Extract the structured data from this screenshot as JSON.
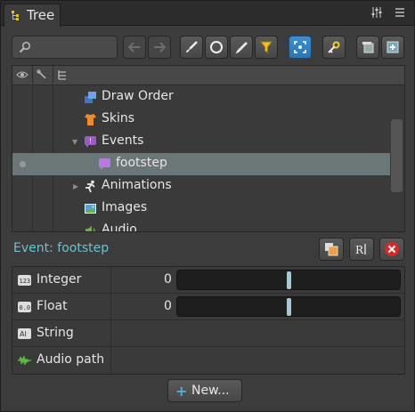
{
  "tab": {
    "title": "Tree",
    "icon": "tree-icon"
  },
  "tab_tools": [
    "settings-sliders-icon",
    "menu-icon"
  ],
  "toolbar": {
    "search_value": "",
    "search_icon": "search-icon",
    "buttons": [
      "back-arrow-icon",
      "forward-arrow-icon",
      "brush-icon",
      "circle-icon",
      "pen-icon",
      "filter-icon",
      "focus-icon",
      "key-icon",
      "collapse-icon",
      "add-panel-icon"
    ],
    "active_accent": "#2f83c8"
  },
  "tree": {
    "columns": [
      "visibility-eye-icon",
      "bone-link-icon",
      "hierarchy-icon"
    ],
    "rows": [
      {
        "label": "Draw Order",
        "icon": "draw-order-icon",
        "expanded": null,
        "selected": false
      },
      {
        "label": "Skins",
        "icon": "skins-icon",
        "expanded": null,
        "selected": false
      },
      {
        "label": "Events",
        "icon": "events-icon",
        "expanded": true,
        "selected": false
      },
      {
        "label": "footstep",
        "icon": "event-speech-icon",
        "expanded": null,
        "selected": true
      },
      {
        "label": "Animations",
        "icon": "animations-icon",
        "expanded": false,
        "selected": false
      },
      {
        "label": "Images",
        "icon": "images-icon",
        "expanded": null,
        "selected": false
      },
      {
        "label": "Audio",
        "icon": "audio-icon",
        "expanded": null,
        "selected": false
      }
    ]
  },
  "properties": {
    "title": "Event: footstep",
    "title_color": "#6bc2d0",
    "actions": [
      "duplicate-icon",
      "rename-icon",
      "delete-icon"
    ],
    "rows": [
      {
        "label": "Integer",
        "icon": "integer-icon",
        "value": "0",
        "slider": 0.5
      },
      {
        "label": "Float",
        "icon": "float-icon",
        "value": "0",
        "slider": 0.5
      },
      {
        "label": "String",
        "icon": "string-icon",
        "value": ""
      },
      {
        "label": "Audio path",
        "icon": "audio-wave-icon",
        "value": ""
      }
    ]
  },
  "new_button": {
    "label": "New..."
  }
}
